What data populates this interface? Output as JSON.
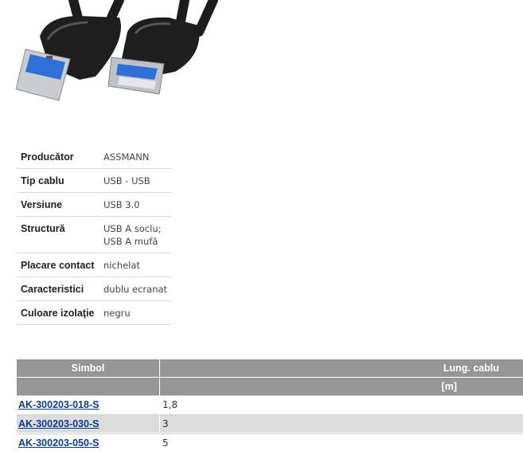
{
  "specs": [
    {
      "label": "Producător",
      "value": "ASSMANN"
    },
    {
      "label": "Tip cablu",
      "value": "USB - USB"
    },
    {
      "label": "Versiune",
      "value": "USB 3.0"
    },
    {
      "label": "Structură",
      "value_lines": [
        "USB A soclu;",
        "USB A mufă"
      ]
    },
    {
      "label": "Placare contact",
      "value": "nichelat"
    },
    {
      "label": "Caracteristici",
      "value": "dublu ecranat"
    },
    {
      "label": "Culoare izolaţie",
      "value": "negru"
    }
  ],
  "products": {
    "headers": {
      "symbol": "Simbol",
      "length": "Lung. cablu",
      "length_unit": "[m]"
    },
    "rows": [
      {
        "symbol": "AK-300203-018-S",
        "length": "1,8"
      },
      {
        "symbol": "AK-300203-030-S",
        "length": "3"
      },
      {
        "symbol": "AK-300203-050-S",
        "length": "5"
      }
    ]
  },
  "colors": {
    "header_bg": "#969696",
    "link": "#0a3d8f",
    "alt_row": "#dcdcdc",
    "usb_blue": "#2f6fd8"
  }
}
